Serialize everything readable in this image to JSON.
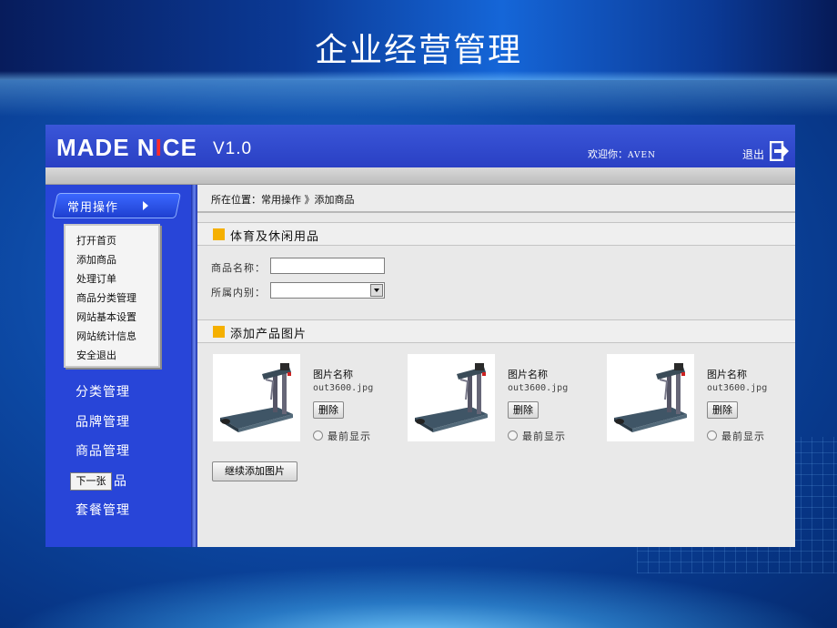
{
  "slide": {
    "title": "企业经营管理"
  },
  "header": {
    "logo_part1": "MADE N",
    "logo_red": "I",
    "logo_part2": "CE",
    "version": "V1.0",
    "welcome": "欢迎你：",
    "user": "AVEN",
    "logout": "退出"
  },
  "sidebar": {
    "menu_head": "常用操作",
    "submenu": [
      "打开首页",
      "添加商品",
      "处理订单",
      "商品分类管理",
      "网站基本设置",
      "网站统计信息",
      "安全退出"
    ],
    "nav": [
      "分类管理",
      "品牌管理",
      "商品管理",
      "品",
      "套餐管理"
    ],
    "tooltip_button": "下一张"
  },
  "main": {
    "breadcrumb": "所在位置：常用操作 》添加商品",
    "section1_title": "体育及休闲用品",
    "name_label": "商品名称：",
    "name_value": "",
    "category_label": "所属内别：",
    "section2_title": "添加产品图片",
    "products": [
      {
        "label": "图片名称",
        "file": "out3600.jpg",
        "delete": "删除",
        "radio_label": "最前显示"
      },
      {
        "label": "图片名称",
        "file": "out3600.jpg",
        "delete": "删除",
        "radio_label": "最前显示"
      },
      {
        "label": "图片名称",
        "file": "out3600.jpg",
        "delete": "删除",
        "radio_label": "最前显示"
      }
    ],
    "add_more": "继续添加图片"
  },
  "colors": {
    "header_blue": "#2a40c4",
    "sidebar_blue": "#2845d8",
    "section_marker": "#f5b000",
    "logo_accent": "#ff2a2a"
  }
}
